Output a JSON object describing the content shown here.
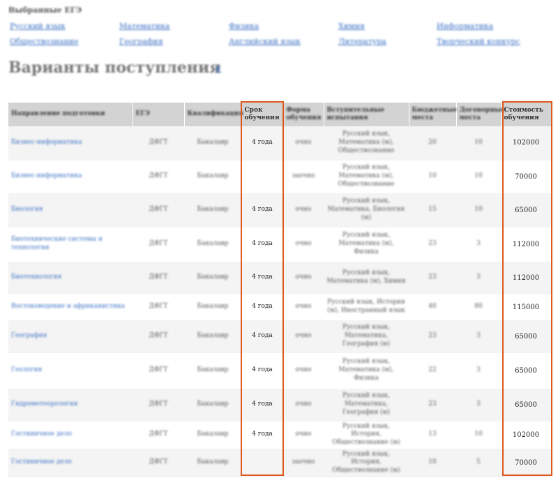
{
  "selected_title": "Выбранные ЕГЭ",
  "subjects": [
    "Русский язык",
    "Математика",
    "Физика",
    "Химия",
    "Информатика",
    "Обществознание",
    "География",
    "Английский язык",
    "Литература",
    "Творческий конкурс"
  ],
  "page_title": "Варианты поступления",
  "page_title_link": "#",
  "table": {
    "headers": [
      "Направление подготовки",
      "ЕГЭ",
      "Квалификация",
      "Срок обучения",
      "Форма обучения",
      "Вступительные испытания",
      "Бюджетные места",
      "Договорные места",
      "Стоимость обучения"
    ],
    "rows": [
      {
        "name": "Бизнес-информатика",
        "ege": "ДФГТ",
        "qual": "Бакалавр",
        "term": "4 года",
        "form": "очно",
        "exams": "Русский язык, Математика (м), Обществознание",
        "budget": "20",
        "paid": "10",
        "cost": "102000"
      },
      {
        "name": "Бизнес-информатика",
        "ege": "ДФГТ",
        "qual": "Бакалавр",
        "term": "",
        "form": "заочно",
        "exams": "Русский язык, Математика (м), Обществознание",
        "budget": "10",
        "paid": "10",
        "cost": "70000"
      },
      {
        "name": "Биология",
        "ege": "ДФГТ",
        "qual": "Бакалавр",
        "term": "4 года",
        "form": "очно",
        "exams": "Русский язык, Математика, Биология (м)",
        "budget": "15",
        "paid": "10",
        "cost": "65000"
      },
      {
        "name": "Биотехнические системы и технологии",
        "ege": "ДФГТ",
        "qual": "Бакалавр",
        "term": "4 года",
        "form": "очно",
        "exams": "Русский язык, Математика (м), Физика",
        "budget": "23",
        "paid": "3",
        "cost": "112000"
      },
      {
        "name": "Биотехнология",
        "ege": "ДФГТ",
        "qual": "Бакалавр",
        "term": "4 года",
        "form": "очно",
        "exams": "Русский язык, Математика (м), Химия",
        "budget": "23",
        "paid": "3",
        "cost": "112000"
      },
      {
        "name": "Востоковедение и африканистика",
        "ege": "ДФГТ",
        "qual": "Бакалавр",
        "term": "4 года",
        "form": "очно",
        "exams": "Русский язык, История (м), Иностранный язык",
        "budget": "40",
        "paid": "80",
        "cost": "115000"
      },
      {
        "name": "География",
        "ege": "ДФГТ",
        "qual": "Бакалавр",
        "term": "4 года",
        "form": "очно",
        "exams": "Русский язык, Математика, География (м)",
        "budget": "23",
        "paid": "3",
        "cost": "65000"
      },
      {
        "name": "Геология",
        "ege": "ДФГТ",
        "qual": "Бакалавр",
        "term": "4 года",
        "form": "очно",
        "exams": "Русский язык, Математика (м), Физика",
        "budget": "22",
        "paid": "3",
        "cost": "65000"
      },
      {
        "name": "Гидрометеорология",
        "ege": "ДФГТ",
        "qual": "Бакалавр",
        "term": "4 года",
        "form": "очно",
        "exams": "Русский язык, Математика, География (м)",
        "budget": "23",
        "paid": "3",
        "cost": "65000"
      },
      {
        "name": "Гостиничное дело",
        "ege": "ДФГТ",
        "qual": "Бакалавр",
        "term": "4 года",
        "form": "очно",
        "exams": "Русский язык, История, Обществознание (м)",
        "budget": "13",
        "paid": "10",
        "cost": "102000"
      },
      {
        "name": "Гостиничное дело",
        "ege": "ДФГТ",
        "qual": "Бакалавр",
        "term": "",
        "form": "заочно",
        "exams": "Русский язык, История, Обществознание (м)",
        "budget": "10",
        "paid": "5",
        "cost": "70000"
      }
    ]
  },
  "highlight_color": "#e0581d",
  "link_color": "#3a6fc4"
}
